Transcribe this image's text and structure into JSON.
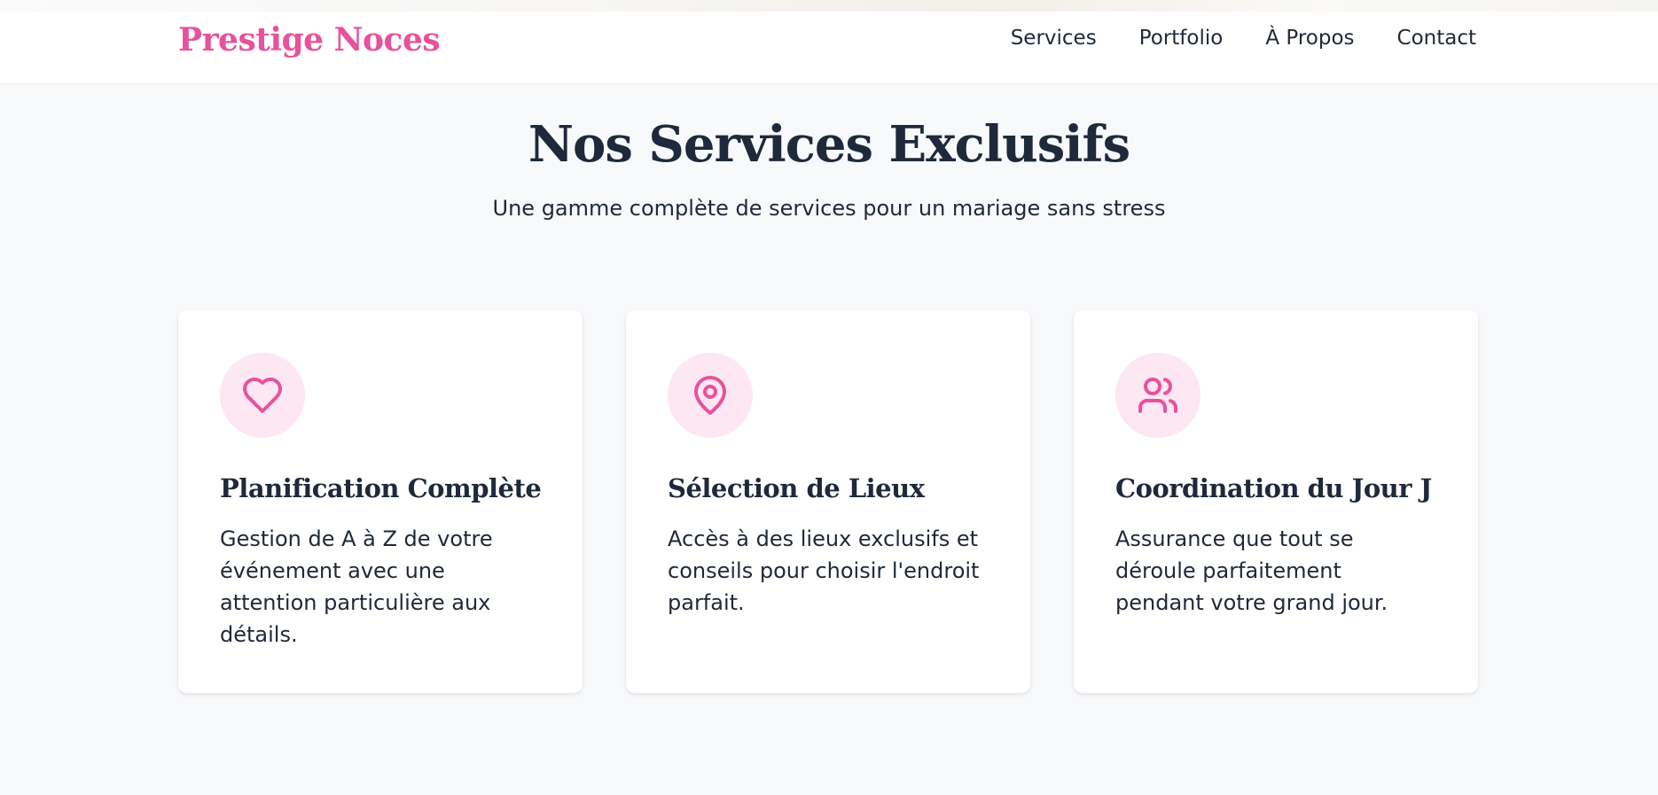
{
  "header": {
    "logo": "Prestige Noces",
    "nav": [
      {
        "label": "Services"
      },
      {
        "label": "Portfolio"
      },
      {
        "label": "À Propos"
      },
      {
        "label": "Contact"
      }
    ]
  },
  "services": {
    "title": "Nos Services Exclusifs",
    "subtitle": "Une gamme complète de services pour un mariage sans stress",
    "cards": [
      {
        "icon": "heart-icon",
        "title": "Planification Complète",
        "description": "Gestion de A à Z de votre événement avec une attention particulière aux détails."
      },
      {
        "icon": "map-pin-icon",
        "title": "Sélection de Lieux",
        "description": "Accès à des lieux exclusifs et conseils pour choisir l'endroit parfait."
      },
      {
        "icon": "users-icon",
        "title": "Coordination du Jour J",
        "description": "Assurance que tout se déroule parfaitement pendant votre grand jour."
      }
    ]
  },
  "colors": {
    "brand": "#e8529a",
    "icon_background": "#fce7f3",
    "page_background": "#f8f9fb",
    "heading": "#1e293b"
  }
}
